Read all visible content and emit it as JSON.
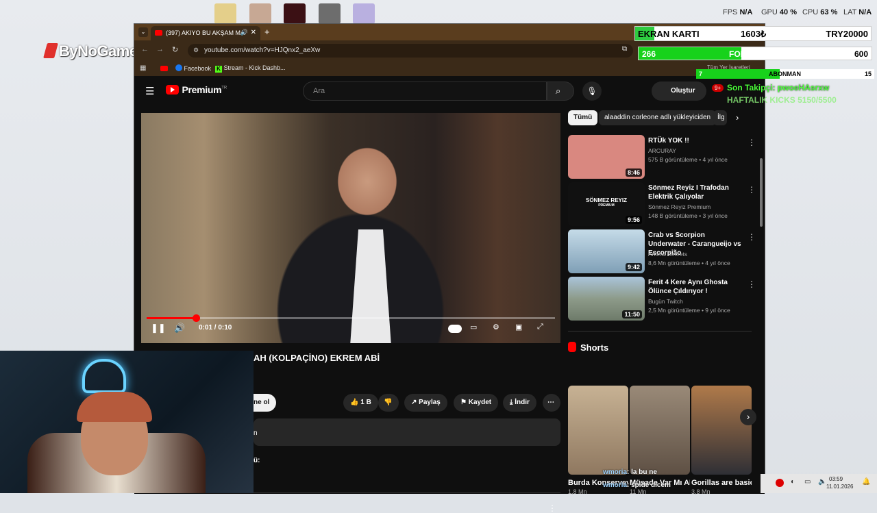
{
  "desktop": {
    "stats": [
      {
        "label": "FPS",
        "value": "N/A"
      },
      {
        "label": "GPU",
        "value": "40 %"
      },
      {
        "label": "CPU",
        "value": "63 %"
      },
      {
        "label": "LAT",
        "value": "N/A"
      }
    ],
    "logo": "ByNoGame",
    "icon_colors": [
      "#e4cf8a",
      "#c7a894",
      "#3b1014",
      "#6d6d6d",
      "#b9b0e0"
    ]
  },
  "browser": {
    "tab_title": "(397) AKIYO BU AKŞAM MA",
    "url": "youtube.com/watch?v=HJQnx2_aeXw",
    "bookmarks": [
      "Facebook",
      "Stream - Kick Dashb...",
      "Tüm Yer İşaretleri"
    ]
  },
  "youtube": {
    "brand": "Premium",
    "region": "TR",
    "search_placeholder": "Ara",
    "create_label": "Oluştur",
    "notif_count": "9+",
    "time": "0:01 / 0:10",
    "progress": 0.12,
    "video_title": "AH (KOLPAÇİNO) EKREM ABİ",
    "subscribe": "ne ol",
    "actions": {
      "like": "1 B",
      "share": "Paylaş",
      "save": "Kaydet",
      "download": "İndir"
    },
    "desc_fragment": "n",
    "comment_fragment": "ü:",
    "chips": [
      "Tümü",
      "alaaddin corleone adlı yükleyiciden",
      "İlg"
    ],
    "recommendations": [
      {
        "title": "RTÜk YOK !!",
        "channel": "ARCURAY",
        "meta": "575 B görüntüleme • 4 yıl önce",
        "duration": "8:46",
        "thumb": "#d98880"
      },
      {
        "title": "Sönmez Reyiz I Trafodan Elektrik Çalıyolar",
        "channel": "Sönmez Reyiz Premium",
        "meta": "148 B görüntüleme • 3 yıl önce",
        "duration": "9:56",
        "thumb": "#111111",
        "thumb_text": "SÖNMEZ REYIZ",
        "thumb_sub": "PREMIUM"
      },
      {
        "title": "Crab vs Scorpion Underwater - Carangueijo vs Escorpião",
        "channel": "Animal Secrets",
        "meta": "8,6 Mn görüntüleme • 4 yıl önce",
        "duration": "9:42",
        "thumb": "#9cbad1"
      },
      {
        "title": "Ferit 4 Kere Aynı Ghosta Ölünce Çıldırıyor !",
        "channel": "Bugün Twitch",
        "meta": "2,5 Mn görüntüleme • 9 yıl önce",
        "duration": "11:50",
        "thumb": "#8d9b8a"
      }
    ],
    "shorts_label": "Shorts",
    "shorts": [
      {
        "title": "Burda Konserveyi",
        "meta": "1,8 Mn",
        "thumb": "#b49a7a"
      },
      {
        "title": "Müsade Var Mı ARUK...",
        "meta": "11 Mn",
        "thumb": "#7a6a5a"
      },
      {
        "title": "Gorillas are basically o...",
        "meta": "3,8 Mn",
        "thumb": "#3a3a40"
      }
    ]
  },
  "overlay": {
    "gpu_label": "EKRAN KARTI",
    "gpu_value": "1603₺",
    "gpu_goal": "TRY20000",
    "gpu_progress": 0.08,
    "followers_current": "266",
    "followers_label": "FOLLOWERS",
    "followers_goal": "600",
    "followers_progress": 0.44,
    "sub_current": "7",
    "sub_label": "ABONMAN",
    "sub_goal": "15",
    "sub_progress": 0.47,
    "last_follower": "Son Takipçi: pwoeHAsrxw",
    "weekly": "HAFTALIK KICKS 5150/5500",
    "chat": [
      {
        "user": "wmoria",
        "msg": ": la bu ne"
      },
      {
        "user": "wmoria",
        "msg": ": spide dicem"
      }
    ]
  },
  "taskbar": {
    "time": "03:59",
    "date": "11.01.2026"
  }
}
